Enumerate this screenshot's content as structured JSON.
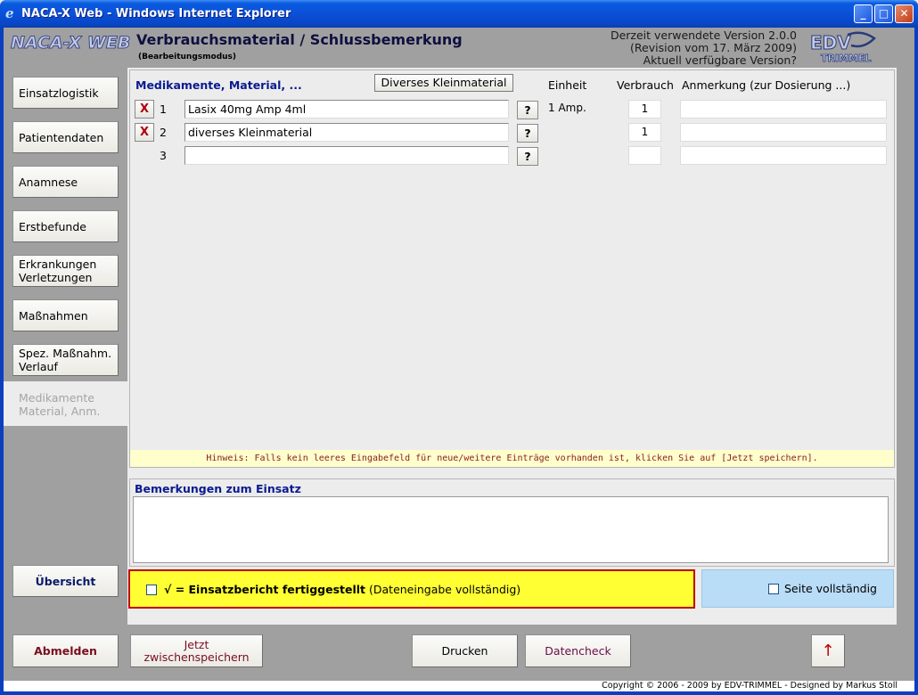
{
  "window": {
    "title": "NACA-X Web - Windows Internet Explorer",
    "minimize": "_",
    "maximize": "□",
    "close": "✕"
  },
  "header": {
    "logo": "NACA-X WEB",
    "page_title": "Verbrauchsmaterial / Schlussbemerkung",
    "mode": "(Bearbeitungsmodus)",
    "version_lines": [
      "Derzeit verwendete Version 2.0.0",
      "(Revision vom 17. März 2009)",
      "Aktuell verfügbare Version?"
    ],
    "vendor_logo": "EDV-TRIMMEL"
  },
  "sidebar": {
    "items": [
      {
        "label": "Einsatzlogistik"
      },
      {
        "label": "Patientendaten"
      },
      {
        "label": "Anamnese"
      },
      {
        "label": "Erstbefunde"
      },
      {
        "label": "Erkrankungen\nVerletzungen"
      },
      {
        "label": "Maßnahmen"
      },
      {
        "label": "Spez. Maßnahm.\nVerlauf"
      },
      {
        "label": "Medikamente\nMaterial, Anm.",
        "active": true
      }
    ],
    "overview": "Übersicht"
  },
  "materials": {
    "col_medikamente": "Medikamente, Material, ...",
    "btn_kleinmaterial": "Diverses Kleinmaterial",
    "col_einheit": "Einheit",
    "col_verbrauch": "Verbrauch",
    "col_anmerkung": "Anmerkung (zur Dosierung ...)",
    "delete_label": "X",
    "help_label": "?",
    "rows": [
      {
        "num": "1",
        "name": "Lasix 40mg Amp 4ml",
        "unit": "1 Amp.",
        "qty": "1",
        "has_delete": true
      },
      {
        "num": "2",
        "name": "diverses Kleinmaterial",
        "unit": "",
        "qty": "1",
        "has_delete": true
      },
      {
        "num": "3",
        "name": "",
        "unit": "",
        "qty": "",
        "has_delete": false
      }
    ],
    "hint": "Hinweis: Falls kein leeres Eingabefeld für neue/weitere Einträge vorhanden ist, klicken Sie auf [Jetzt speichern]."
  },
  "remarks": {
    "label": "Bemerkungen zum Einsatz",
    "value": ""
  },
  "completion": {
    "final_bold": "√ = Einsatzbericht fertiggestellt",
    "final_rest": " (Dateneingabe vollständig)",
    "final_checked": false,
    "page_label": "Seite vollständig",
    "page_checked": false
  },
  "footer": {
    "logout": "Abmelden",
    "save": "Jetzt zwischenspeichern",
    "print": "Drucken",
    "check": "Datencheck",
    "up": "↑",
    "copyright": "Copyright © 2006 - 2009 by EDV-TRIMMEL - Designed by Markus Stoll"
  },
  "colors": {
    "titlebar": "#0a50d8",
    "gray_bg": "#a0a0a0",
    "panel_bg": "#ececec",
    "label_blue": "#0a1a90",
    "hint_bg": "#ffffcc",
    "final_bg": "#ffff33",
    "final_border": "#c00000",
    "page_bg": "#b9dcf7"
  }
}
